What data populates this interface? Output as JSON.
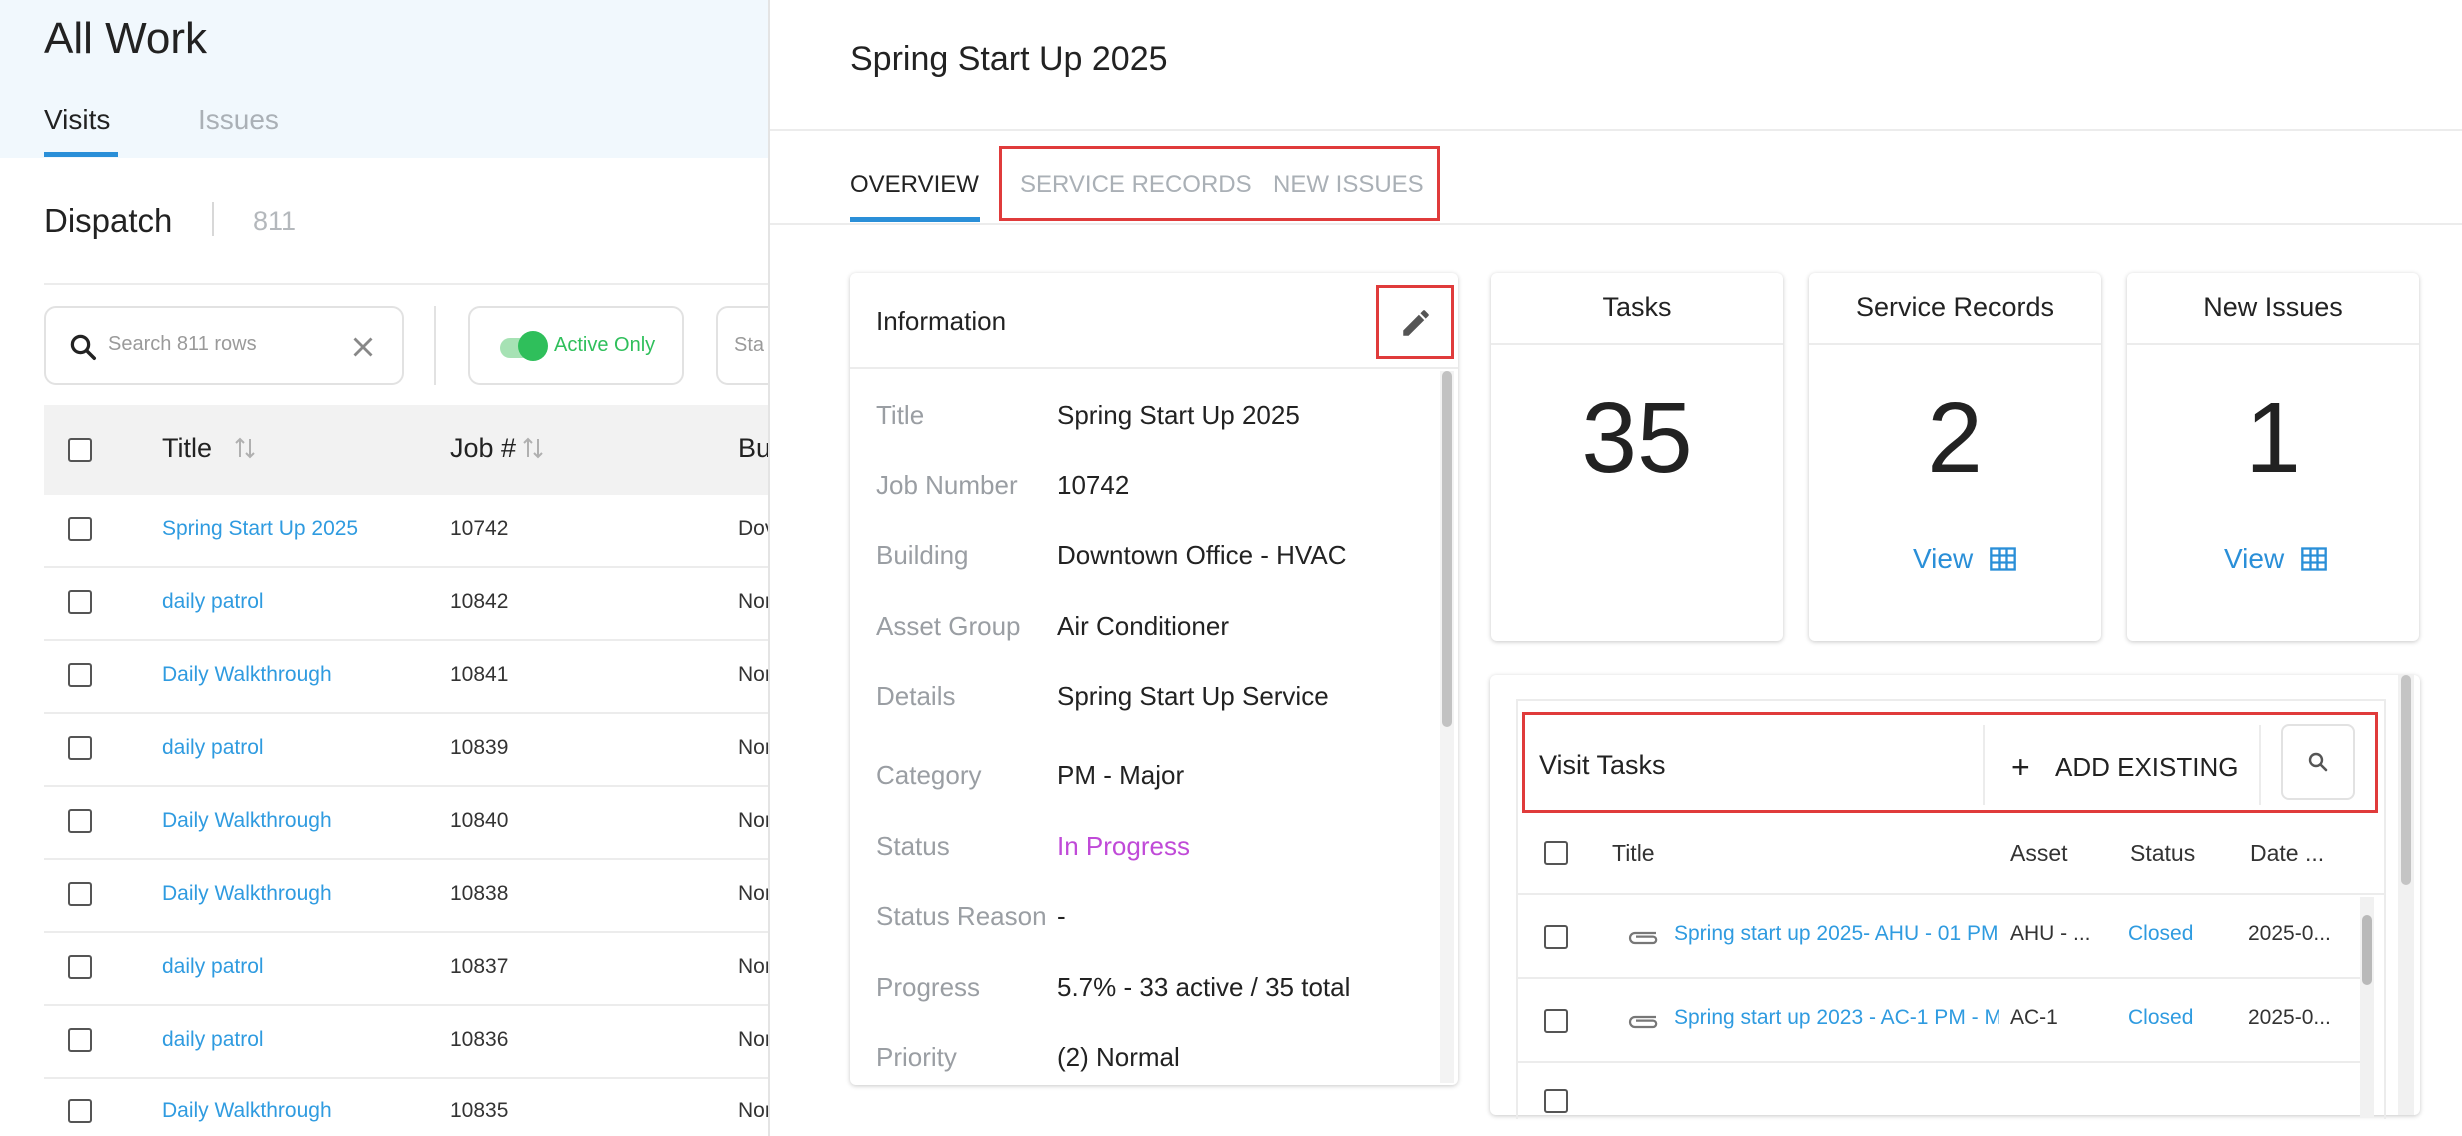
{
  "left": {
    "title": "All Work",
    "tabs": [
      {
        "label": "Visits",
        "active": true
      },
      {
        "label": "Issues",
        "active": false
      }
    ],
    "dispatch": {
      "label": "Dispatch",
      "count": "811"
    },
    "search": {
      "placeholder": "Search 811 rows"
    },
    "filters": {
      "active_only": "Active Only",
      "status_partial": "Sta"
    },
    "table": {
      "columns": [
        "Title",
        "Job #",
        "Bu"
      ],
      "rows": [
        {
          "title": "Spring Start Up 2025",
          "job": "10742",
          "bu": "Dov"
        },
        {
          "title": "daily patrol",
          "job": "10842",
          "bu": "Nor"
        },
        {
          "title": "Daily Walkthrough",
          "job": "10841",
          "bu": "Nor"
        },
        {
          "title": "daily patrol",
          "job": "10839",
          "bu": "Nor"
        },
        {
          "title": "Daily Walkthrough",
          "job": "10840",
          "bu": "Nor"
        },
        {
          "title": "Daily Walkthrough",
          "job": "10838",
          "bu": "Nor"
        },
        {
          "title": "daily patrol",
          "job": "10837",
          "bu": "Nor"
        },
        {
          "title": "daily patrol",
          "job": "10836",
          "bu": "Nor"
        },
        {
          "title": "Daily Walkthrough",
          "job": "10835",
          "bu": "Nor"
        }
      ]
    }
  },
  "detail": {
    "title": "Spring Start Up 2025",
    "tabs": [
      "OVERVIEW",
      "SERVICE RECORDS",
      "NEW ISSUES"
    ],
    "info": {
      "title": "Information",
      "fields": [
        {
          "label": "Title",
          "value": "Spring Start Up 2025"
        },
        {
          "label": "Job Number",
          "value": "10742"
        },
        {
          "label": "Building",
          "value": "Downtown Office - HVAC"
        },
        {
          "label": "Asset Group",
          "value": "Air Conditioner"
        },
        {
          "label": "Details",
          "value": "Spring Start Up Service"
        },
        {
          "label": "Category",
          "value": "PM - Major"
        },
        {
          "label": "Status",
          "value": "In Progress"
        },
        {
          "label": "Status Reason",
          "value": "-"
        },
        {
          "label": "Progress",
          "value": "5.7% - 33 active / 35 total"
        },
        {
          "label": "Priority",
          "value": "(2) Normal"
        }
      ]
    },
    "stats": [
      {
        "title": "Tasks",
        "value": "35"
      },
      {
        "title": "Service Records",
        "value": "2",
        "link": "View"
      },
      {
        "title": "New Issues",
        "value": "1",
        "link": "View"
      }
    ],
    "visit_tasks": {
      "title": "Visit Tasks",
      "add_label": "ADD EXISTING",
      "columns": [
        "Title",
        "Asset",
        "Status",
        "Date ..."
      ],
      "rows": [
        {
          "title": "Spring start up 2025- AHU - 01 PM",
          "asset": "AHU - ...",
          "status": "Closed",
          "date": "2025-0..."
        },
        {
          "title": "Spring start up 2023 - AC-1 PM - M",
          "asset": "AC-1",
          "status": "Closed",
          "date": "2025-0..."
        }
      ]
    }
  },
  "colors": {
    "link": "#2f9be0",
    "accent": "#2a8fd8",
    "status_in_progress": "#c04ad8",
    "toggle_on": "#2fbf5b",
    "highlight": "#e03b3b"
  },
  "icons": [
    "search-icon",
    "clear-icon",
    "sort-icon",
    "edit-icon",
    "grid-icon",
    "plus-icon",
    "attachment-icon"
  ]
}
